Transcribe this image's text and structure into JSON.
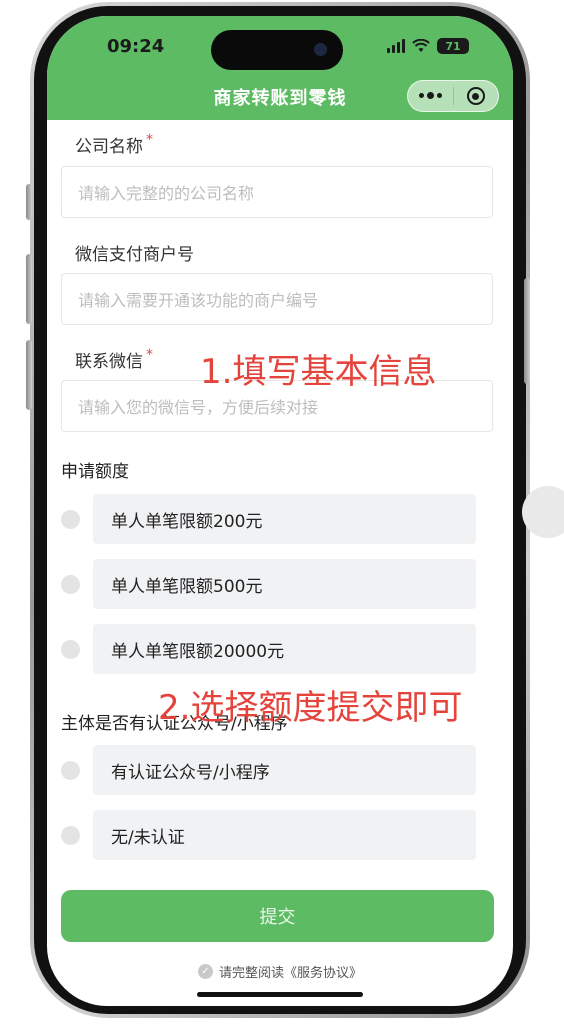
{
  "status_bar": {
    "time": "09:24",
    "battery": "71"
  },
  "header": {
    "title": "商家转账到零钱"
  },
  "form": {
    "company_label": "公司名称",
    "company_placeholder": "请输入完整的的公司名称",
    "merchant_label": "微信支付商户号",
    "merchant_placeholder": "请输入需要开通该功能的商户编号",
    "wechat_label": "联系微信",
    "wechat_placeholder": "请输入您的微信号，方便后续对接",
    "required_mark": "*"
  },
  "quota": {
    "title": "申请额度",
    "options": [
      "单人单笔限额200元",
      "单人单笔限额500元",
      "单人单笔限额20000元"
    ]
  },
  "certification": {
    "title": "主体是否有认证公众号/小程序",
    "options": [
      "有认证公众号/小程序",
      "无/未认证"
    ]
  },
  "submit_label": "提交",
  "agreement": {
    "check_mark": "✓",
    "text": "请完整阅读《服务协议》"
  },
  "annotations": {
    "step1": "1.填写基本信息",
    "step2": "2.选择额度提交即可"
  },
  "colors": {
    "primary": "#5dbb63",
    "annotation": "#e4443c",
    "required": "#e04848"
  }
}
